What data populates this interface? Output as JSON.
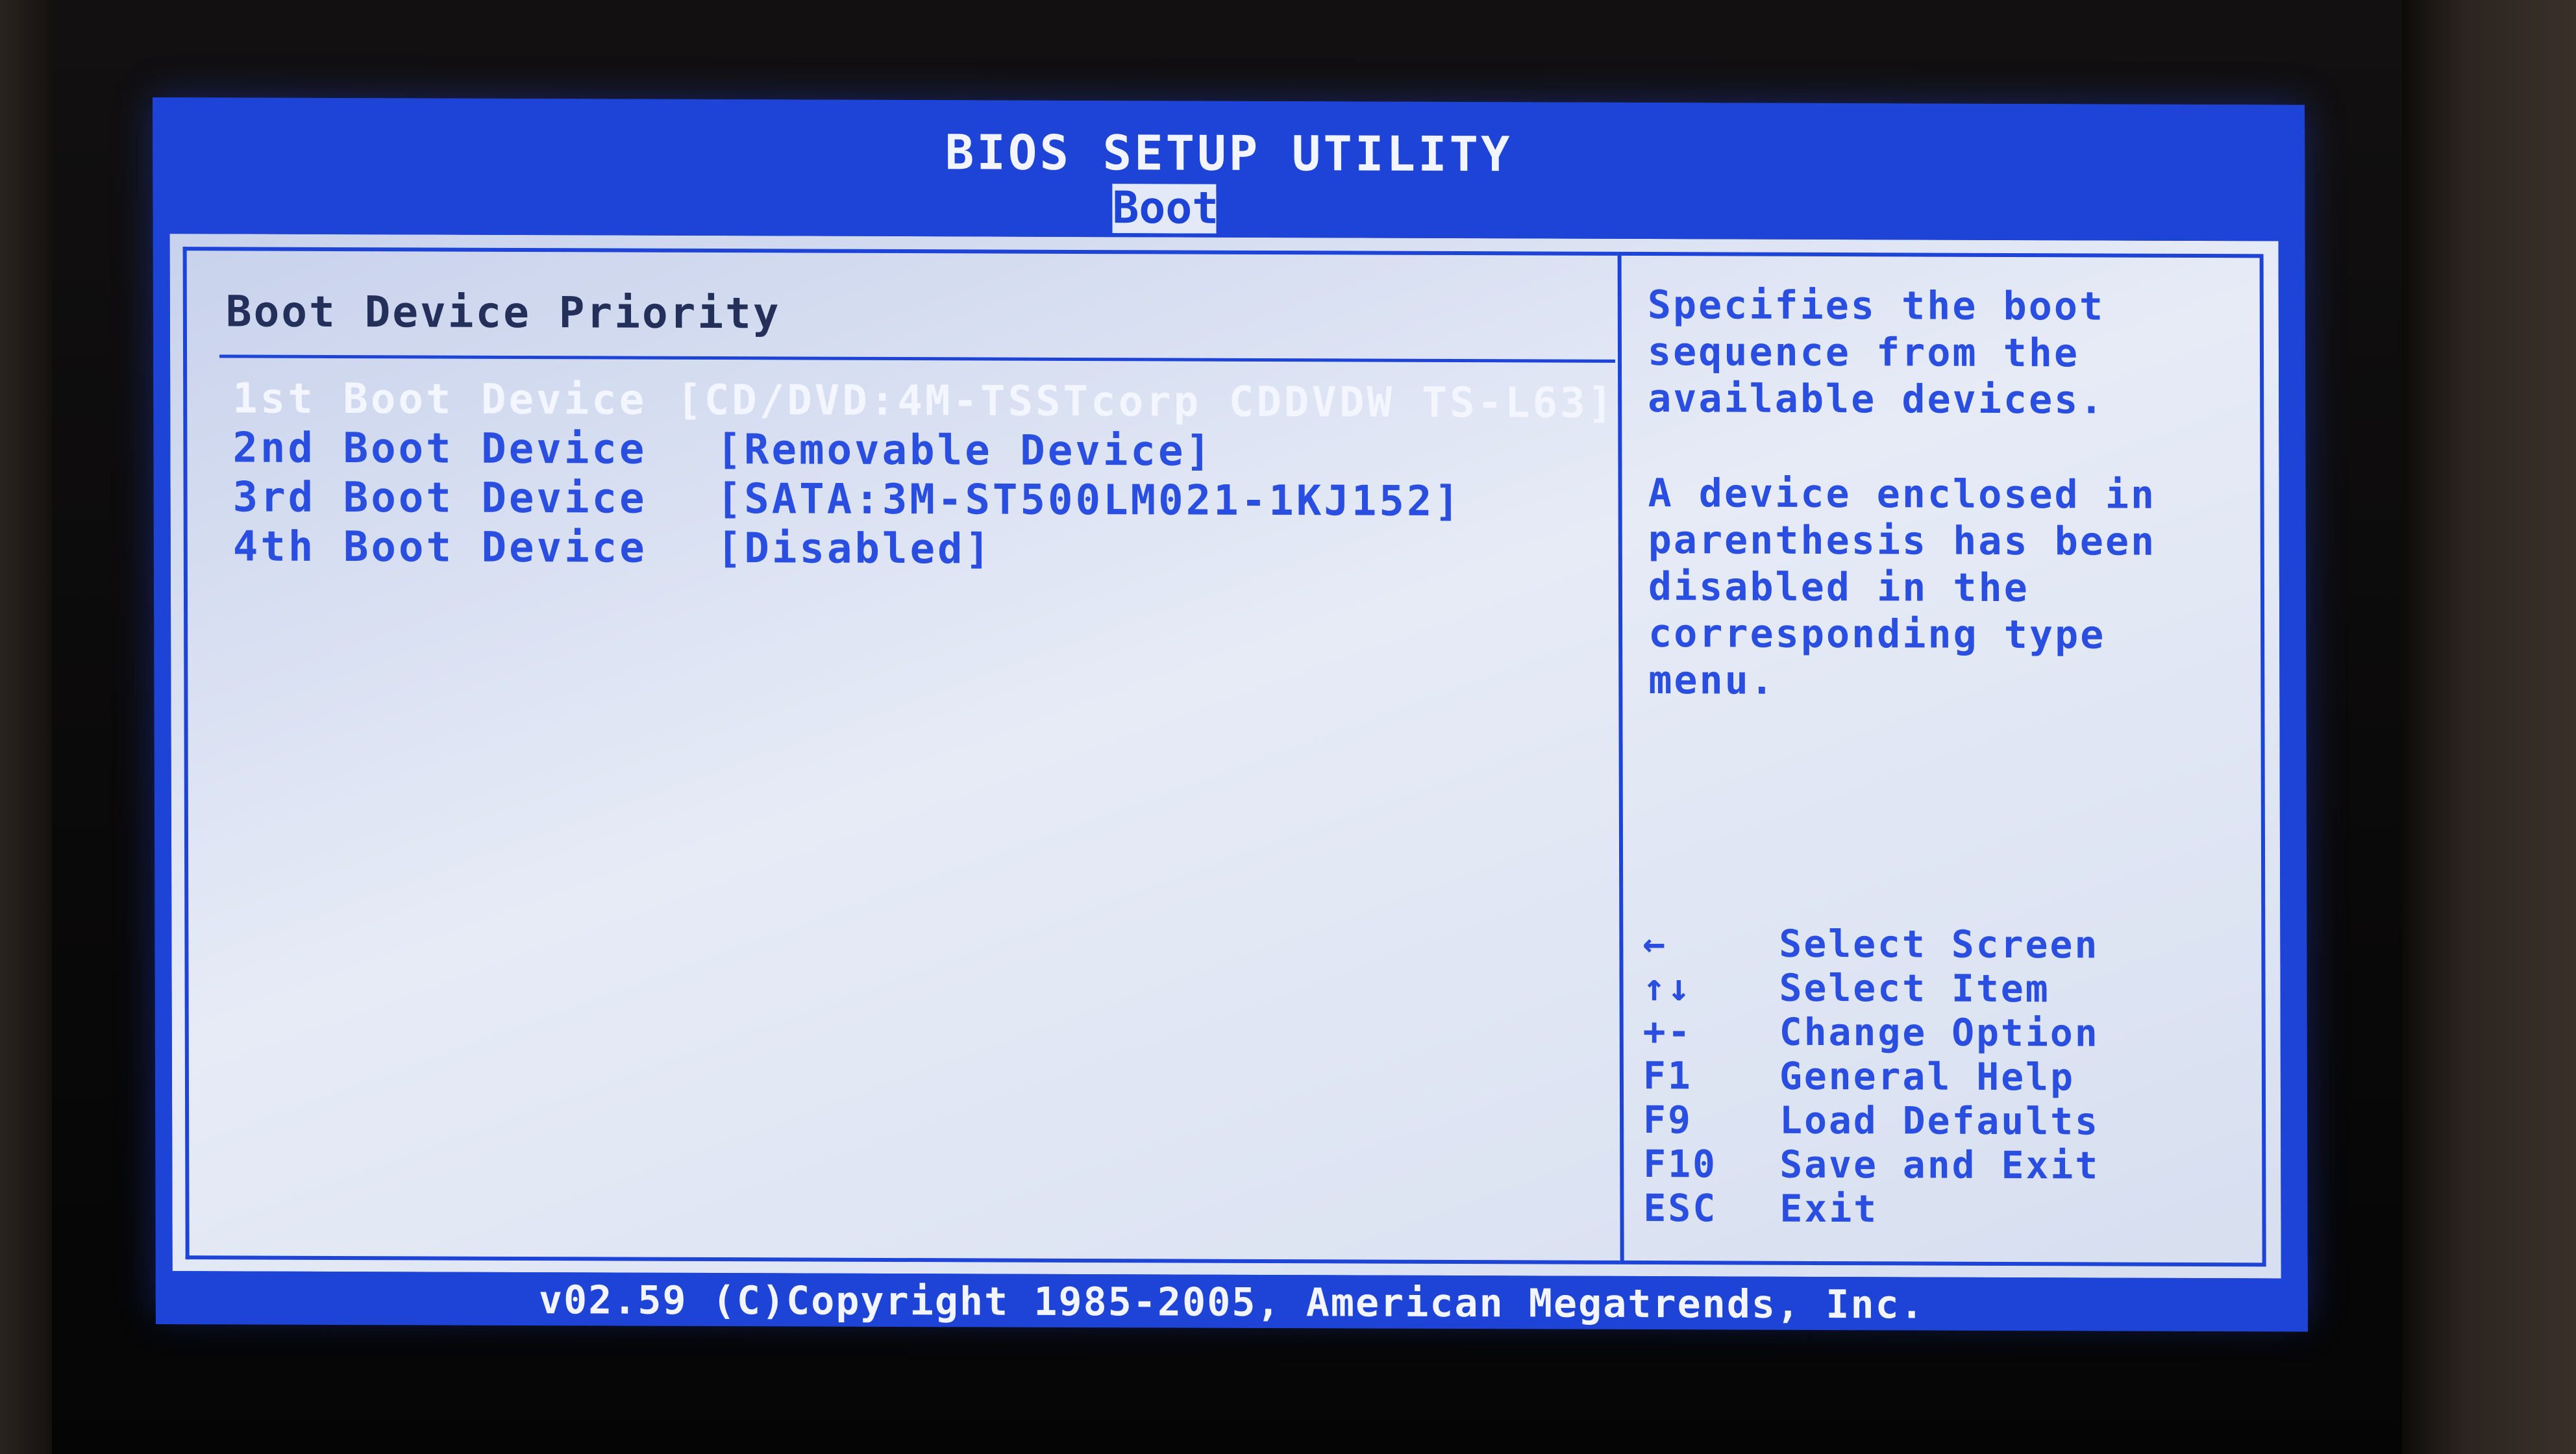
{
  "header": {
    "title": "BIOS SETUP UTILITY",
    "active_tab": "Boot"
  },
  "section": {
    "title": "Boot Device Priority"
  },
  "boot_devices": [
    {
      "label": "1st Boot Device",
      "value": "[CD/DVD:4M-TSSTcorp CDDVDW TS-L63]",
      "selected": true
    },
    {
      "label": "2nd Boot Device",
      "value": "[Removable Device]",
      "selected": false
    },
    {
      "label": "3rd Boot Device",
      "value": "[SATA:3M-ST500LM021-1KJ152]",
      "selected": false
    },
    {
      "label": "4th Boot Device",
      "value": "[Disabled]",
      "selected": false
    }
  ],
  "help": {
    "description": [
      "Specifies the boot",
      "sequence from the",
      "available devices."
    ],
    "note": [
      "A device enclosed in",
      "parenthesis has been",
      "disabled in the",
      "corresponding type",
      "menu."
    ]
  },
  "keys": [
    {
      "key": "←",
      "action": "Select Screen"
    },
    {
      "key": "↑↓",
      "action": "Select Item"
    },
    {
      "key": "+-",
      "action": "Change Option"
    },
    {
      "key": "F1",
      "action": "General Help"
    },
    {
      "key": "F9",
      "action": "Load Defaults"
    },
    {
      "key": "F10",
      "action": "Save and Exit"
    },
    {
      "key": "ESC",
      "action": "Exit"
    }
  ],
  "footer": {
    "text": "v02.59 (C)Copyright 1985-2005, American Megatrends, Inc."
  },
  "colors": {
    "bios_blue": "#1d44d6",
    "panel_grey": "#e3e9f7",
    "highlight_text": "#f4f6ff"
  }
}
